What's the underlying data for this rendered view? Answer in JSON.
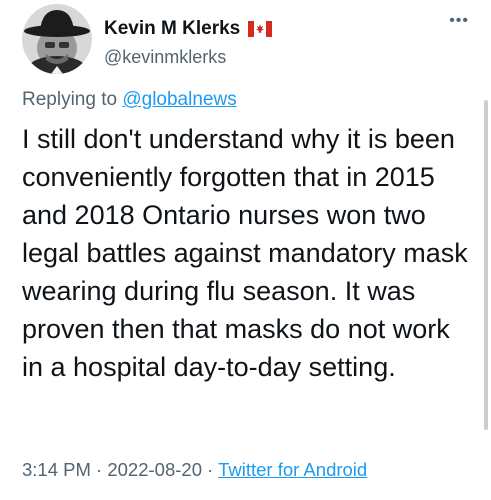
{
  "author": {
    "display_name": "Kevin M Klerks",
    "handle": "@kevinmklerks",
    "flag": "canada-flag-icon"
  },
  "reply": {
    "prefix": "Replying to ",
    "to": "@globalnews"
  },
  "tweet": {
    "text": "I still don't understand why it is been conveniently forgotten that in 2015 and 2018 Ontario nurses won two legal battles against mandatory mask wearing during flu season. It was proven then that masks do not work in a hospital day-to-day setting."
  },
  "meta": {
    "time": "3:14 PM",
    "separator1": " · ",
    "date": "2022-08-20",
    "separator2": " · ",
    "source": "Twitter for Android"
  },
  "more_label": "•••",
  "colors": {
    "link": "#1d9bf0",
    "muted": "#536471",
    "text": "#0f1419",
    "flag_red": "#d52b1e"
  }
}
